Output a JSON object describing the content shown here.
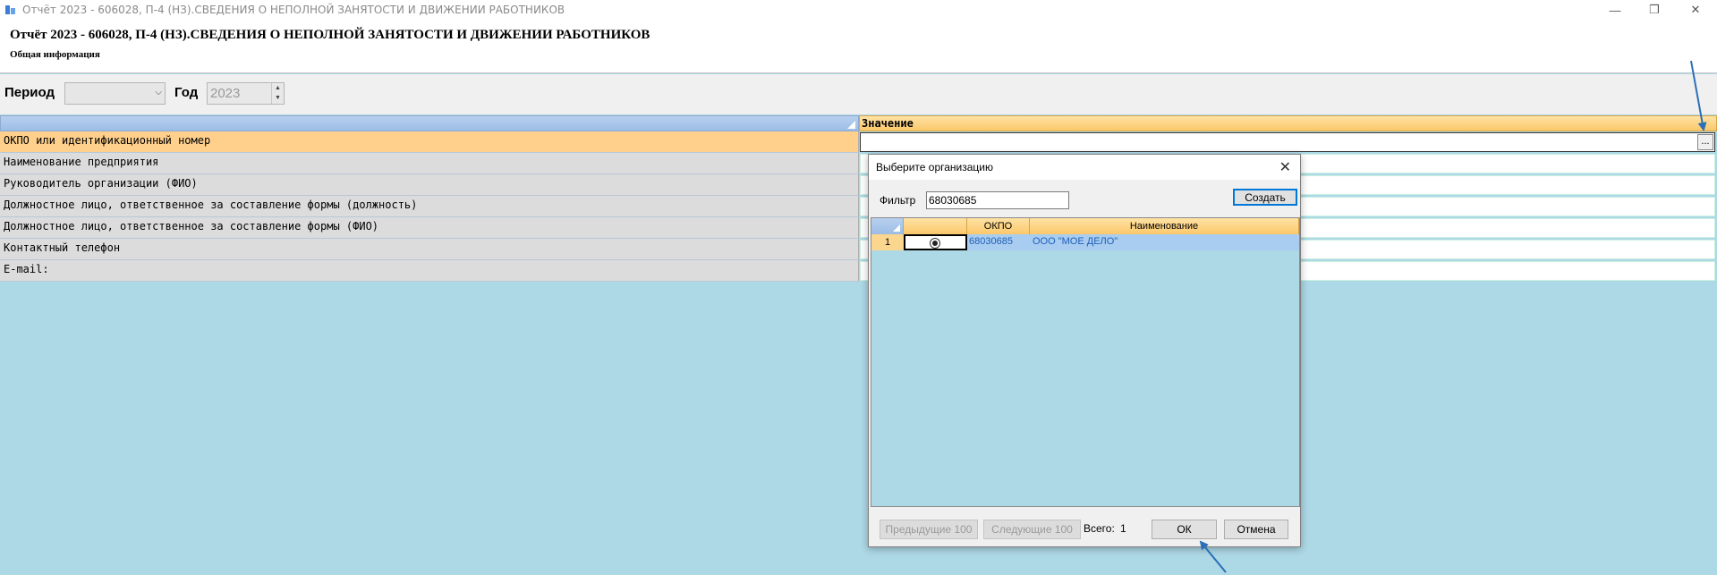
{
  "window": {
    "title": "Отчёт 2023 - 606028, П-4 (НЗ).СВЕДЕНИЯ О НЕПОЛНОЙ ЗАНЯТОСТИ И ДВИЖЕНИИ РАБОТНИКОВ",
    "minimize": "—",
    "restore": "❐",
    "close": "✕"
  },
  "header": {
    "title": "Отчёт 2023 - 606028, П-4 (НЗ).СВЕДЕНИЯ О НЕПОЛНОЙ ЗАНЯТОСТИ И ДВИЖЕНИИ РАБОТНИКОВ",
    "subtitle": "Общая информация"
  },
  "period": {
    "period_label": "Период",
    "period_value": "",
    "year_label": "Год",
    "year_value": "2023"
  },
  "grid": {
    "value_header": "Значение",
    "rows": [
      {
        "label": "ОКПО или идентификационный номер",
        "value": ""
      },
      {
        "label": "Наименование предприятия",
        "value": ""
      },
      {
        "label": "Руководитель организации (ФИО)",
        "value": ""
      },
      {
        "label": "Должностное лицо, ответственное за составление формы (должность)",
        "value": ""
      },
      {
        "label": "Должностное лицо, ответственное за составление формы (ФИО)",
        "value": ""
      },
      {
        "label": "Контактный телефон",
        "value": ""
      },
      {
        "label": "E-mail:",
        "value": ""
      }
    ],
    "ellipsis_label": "..."
  },
  "dialog": {
    "title": "Выберите организацию",
    "close": "✕",
    "filter_label": "Фильтр",
    "filter_value": "68030685",
    "create_label": "Создать",
    "columns": [
      "ОКПО",
      "Наименование"
    ],
    "rows": [
      {
        "num": "1",
        "okpo": "68030685",
        "name": "ООО  \"МОЕ ДЕЛО\""
      }
    ],
    "prev_label": "Предыдущие 100",
    "next_label": "Следующие 100",
    "total_label": "Всего:",
    "total_value": "1",
    "ok_label": "ОК",
    "cancel_label": "Отмена"
  },
  "colors": {
    "selected_row": "#ffd08c",
    "background": "#add8e6",
    "accent": "#0078d7"
  }
}
